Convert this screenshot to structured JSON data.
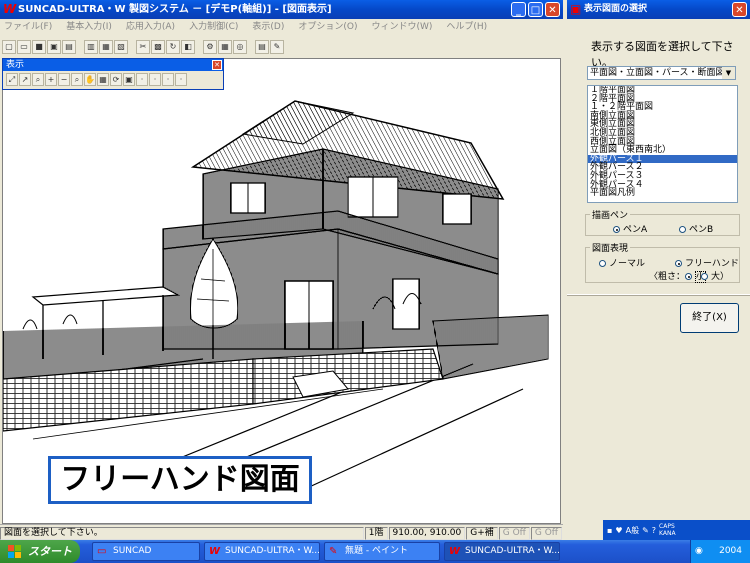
{
  "main_window": {
    "title": "SUNCAD-ULTRA・W 製図システム － [デモP(軸組)] - [図面表示]",
    "menu": [
      "ファイル(F)",
      "基本入力(I)",
      "応用入力(A)",
      "入力制御(C)",
      "表示(D)",
      "オプション(O)",
      "ウィンドウ(W)",
      "ヘルプ(H)"
    ],
    "palette_title": "表示",
    "caption": "フリーハンド図面",
    "status": {
      "message": "図面を選択して下さい。",
      "floor": "1階",
      "coords": "910.00, 910.00",
      "grid": "G+補",
      "g_off": "G Off",
      "g_off2": "G Off"
    }
  },
  "dialog": {
    "title": "表示図面の選択",
    "prompt": "表示する図面を選択して下さい。",
    "combo_value": "平面図・立面図・パース・断面図",
    "list_items": [
      "１階平面図",
      "２階平面図",
      "１・２階平面図",
      "南側立面図",
      "東側立面図",
      "北側立面図",
      "西側立面図",
      "立面図（東西南北）",
      "外観パース１",
      "外観パース２",
      "外観パース３",
      "外観パース４",
      "平面図凡例"
    ],
    "selected_index": 8,
    "pen_group_label": "描画ペン",
    "pen_a": "ペンA",
    "pen_b": "ペンB",
    "expr_group_label": "図面表現",
    "normal": "ノーマル",
    "freehand": "フリーハンド",
    "thickness_label": "〈粗さ：",
    "small": "小",
    "large": "大）",
    "end_button": "終了(X)"
  },
  "tray": {
    "caps": "CAPS",
    "kana": "KANA",
    "ime": "A般",
    "clock": "2004"
  },
  "taskbar": {
    "start": "スタート",
    "items": [
      "SUNCAD",
      "SUNCAD-ULTRA・W...",
      "無題 - ペイント",
      "SUNCAD-ULTRA・W..."
    ]
  }
}
